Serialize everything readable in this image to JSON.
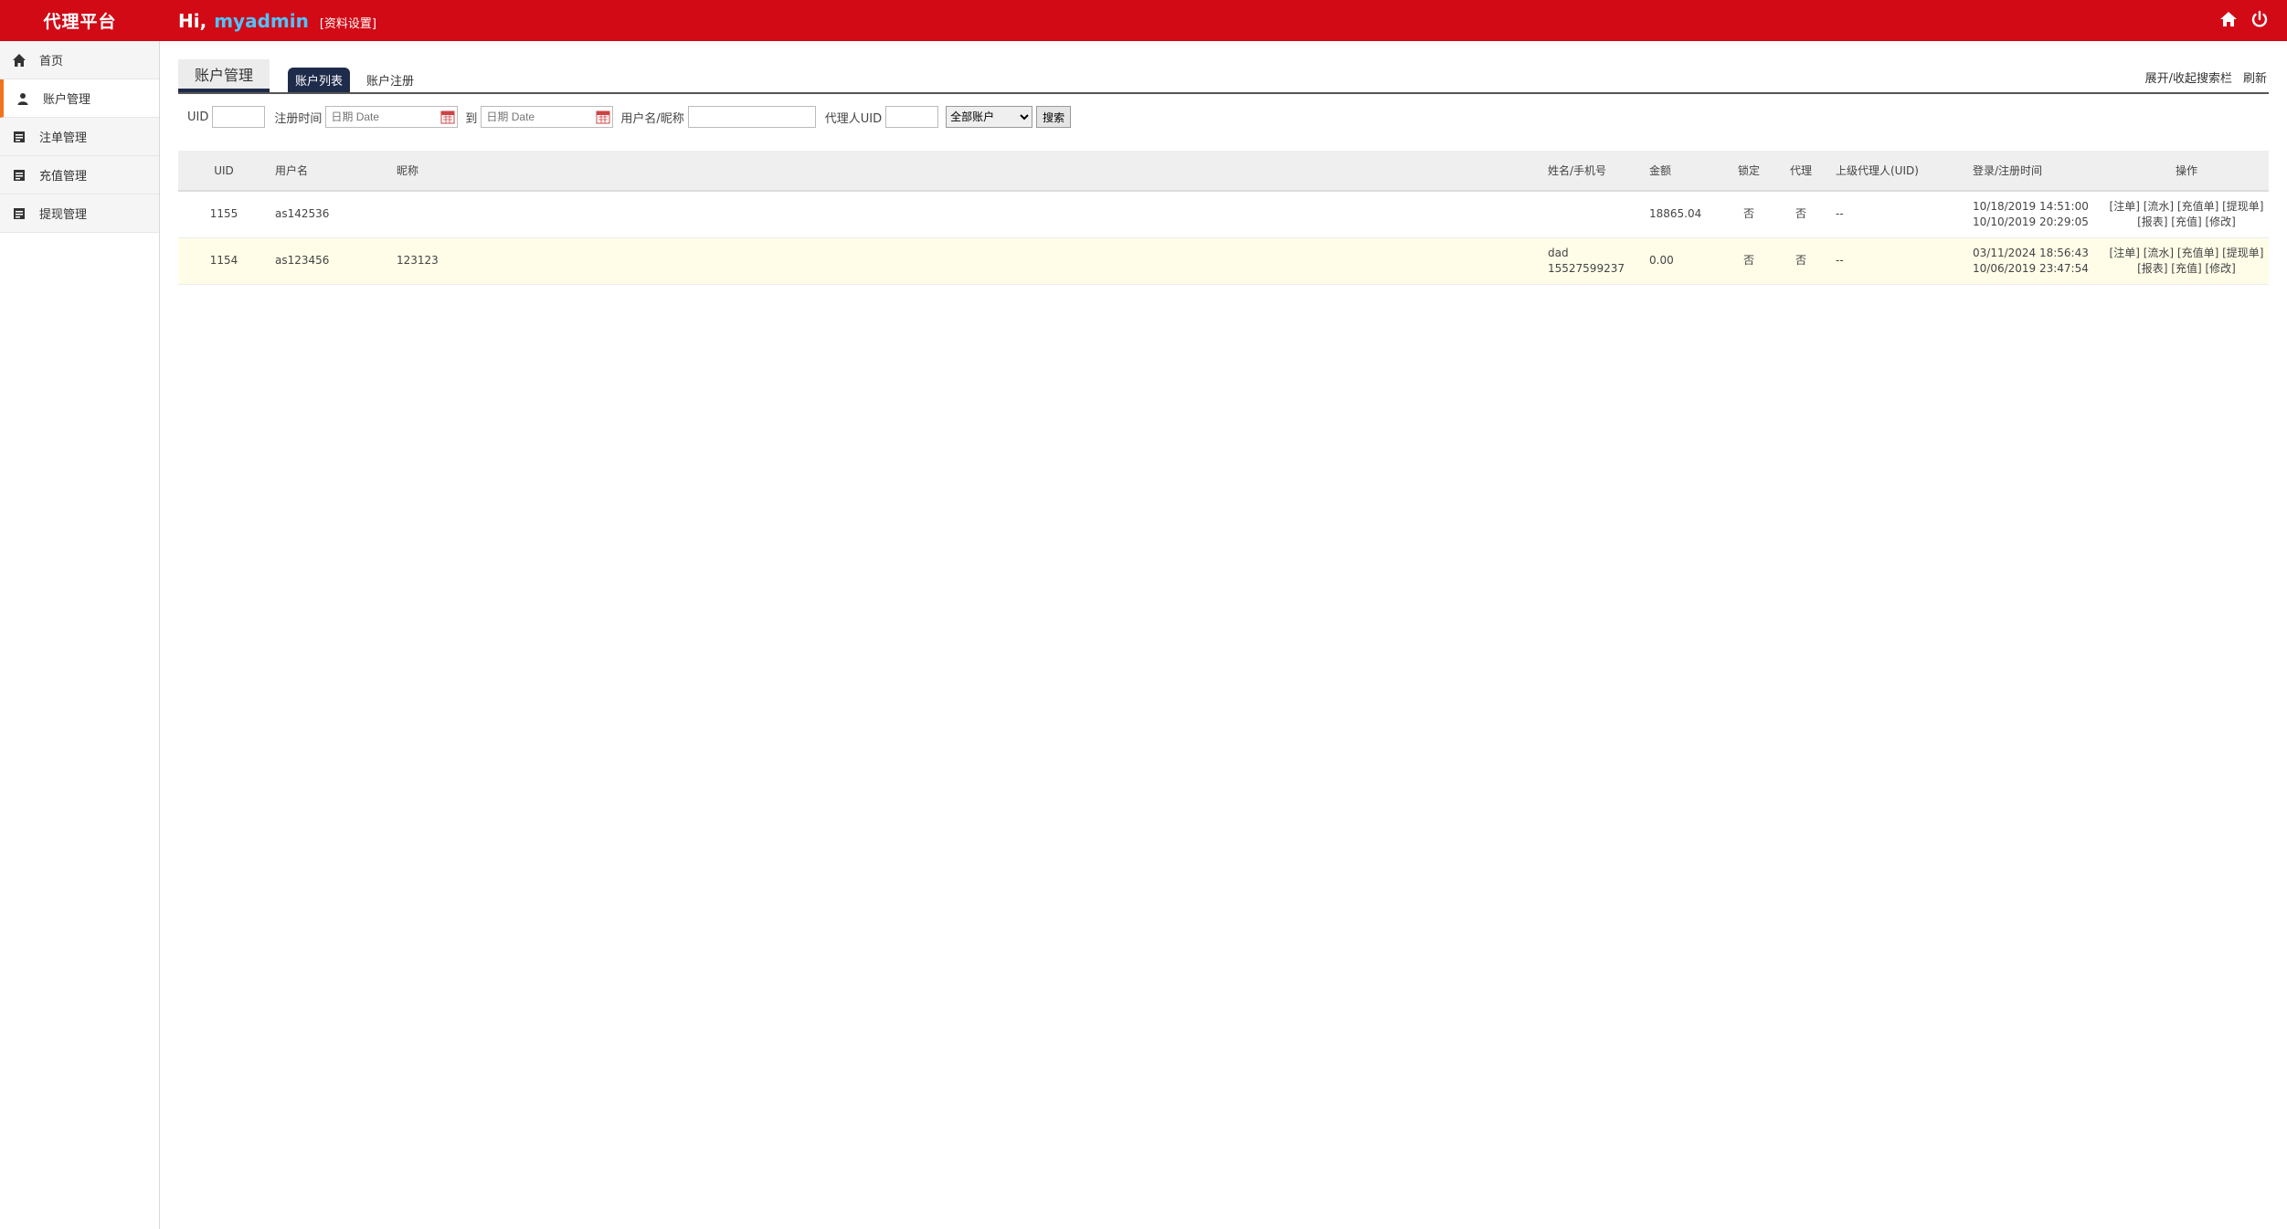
{
  "app": {
    "brand": "代理平台",
    "greeting": "Hi,",
    "username": "myadmin",
    "profile_link": "[资料设置]"
  },
  "sidebar": {
    "items": [
      {
        "label": "首页",
        "icon": "home-icon"
      },
      {
        "label": "账户管理",
        "icon": "user-icon"
      },
      {
        "label": "注单管理",
        "icon": "list-icon"
      },
      {
        "label": "充值管理",
        "icon": "list-icon"
      },
      {
        "label": "提现管理",
        "icon": "list-icon"
      }
    ],
    "active_index": 1
  },
  "main": {
    "page_tab": "账户管理",
    "subtabs": [
      "账户列表",
      "账户注册"
    ],
    "right_links": [
      "展开/收起搜索栏",
      "刷新"
    ]
  },
  "search": {
    "uid_label": "UID",
    "reg_time_label": "注册时间",
    "date_placeholder_from": "日期 Date",
    "to_label": "到",
    "date_placeholder_to": "日期 Date",
    "name_label": "用户名/昵称",
    "agent_uid_label": "代理人UID",
    "account_filter_selected": "全部账户",
    "search_button": "搜索"
  },
  "table": {
    "columns": [
      "UID",
      "用户名",
      "昵称",
      "姓名/手机号",
      "金额",
      "锁定",
      "代理",
      "上级代理人(UID)",
      "登录/注册时间",
      "操作"
    ],
    "rows": [
      {
        "uid": "1155",
        "username": "as142536",
        "nickname": "",
        "name": "",
        "phone": "",
        "amount": "18865.04",
        "locked": "否",
        "agent": "否",
        "parent": "--",
        "login_time": "10/18/2019 14:51:00",
        "reg_time": "10/10/2019 20:29:05",
        "ops_line1": "[注单] [流水] [充值单] [提现单]",
        "ops_line2": "[报表] [充值] [修改]"
      },
      {
        "uid": "1154",
        "username": "as123456",
        "nickname": "123123",
        "name": "dad",
        "phone": "15527599237",
        "amount": "0.00",
        "locked": "否",
        "agent": "否",
        "parent": "--",
        "login_time": "03/11/2024 18:56:43",
        "reg_time": "10/06/2019 23:47:54",
        "ops_line1": "[注单] [流水] [充值单] [提现单]",
        "ops_line2": "[报表] [充值] [修改]"
      }
    ]
  },
  "colors": {
    "topbar": "#d10a16",
    "username": "#4fc3ff",
    "active_sidebar_accent": "#f0731e",
    "active_subtab": "#1f2b4b",
    "highlight_row": "#fffde8"
  }
}
